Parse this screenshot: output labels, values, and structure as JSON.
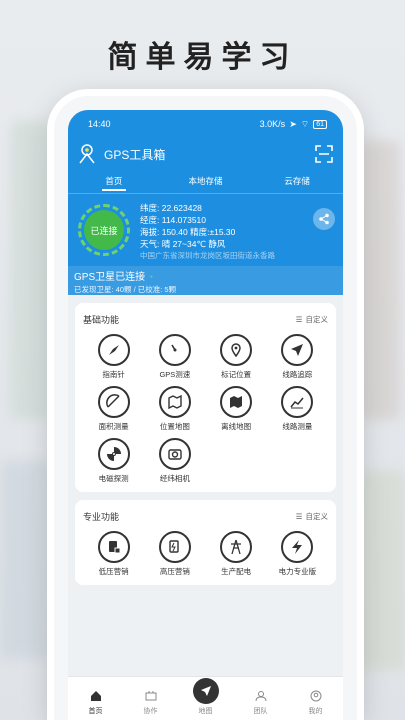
{
  "headline": "简单易学习",
  "status": {
    "time": "14:40",
    "net": "3.0K/s",
    "battery": "61"
  },
  "app": {
    "title": "GPS工具箱"
  },
  "tabs": [
    "首页",
    "本地存储",
    "云存储"
  ],
  "location": {
    "connect_label": "已连接",
    "lat": "纬度: 22.623428",
    "lon": "经度: 114.073510",
    "alt_acc": "海拔: 150.40    精度:±15.30",
    "weather": "天气: 晴 27~34℃ 静风",
    "address": "中国广东省深圳市龙岗区坂田街道永香路"
  },
  "gps": {
    "title": "GPS卫星已连接",
    "detail": "已发现卫星: 40颗 / 已校准: 5颗"
  },
  "basic": {
    "title": "基础功能",
    "custom": "自定义",
    "items": [
      "指南针",
      "GPS测速",
      "标记位置",
      "线路追踪",
      "面积测量",
      "位置地图",
      "离线地图",
      "线路测量",
      "电磁探测",
      "经纬相机"
    ]
  },
  "pro": {
    "title": "专业功能",
    "custom": "自定义",
    "items": [
      "低压营销",
      "高压营销",
      "生产配电",
      "电力专业版"
    ]
  },
  "nav": [
    "首页",
    "协作",
    "地图",
    "团队",
    "我的"
  ],
  "colors": {
    "primary": "#1d8fe0",
    "connected": "#43b94a"
  }
}
